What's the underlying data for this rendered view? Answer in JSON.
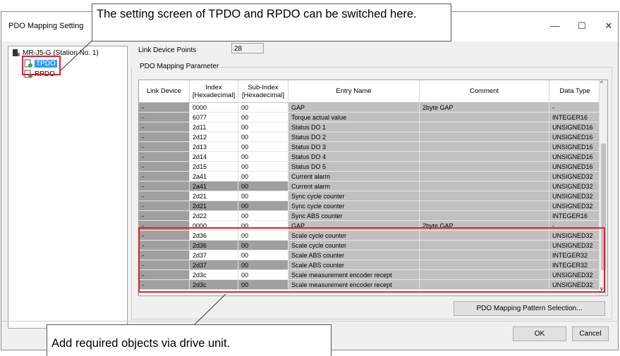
{
  "window": {
    "title": "PDO Mapping Setting",
    "minimize": "—",
    "maximize": "☐",
    "close": "✕"
  },
  "tree": {
    "station": "MR-J5-G (Station No. 1)",
    "tpdo": "TPDO",
    "rpdo": "RPDO"
  },
  "link_points": {
    "label": "Link Device Points",
    "value": "28"
  },
  "group_label": "PDO Mapping Parameter",
  "table": {
    "headers": {
      "link": "Link Device",
      "index": "Index [Hexadecimal]",
      "sub": "Sub-Index [Hexadecimal]",
      "entry": "Entry Name",
      "comment": "Comment",
      "type": "Data Type"
    },
    "rows": [
      {
        "link": "-",
        "index": "0000",
        "sub": "00",
        "entry": "GAP",
        "comment": "2byte GAP",
        "type": "-"
      },
      {
        "link": "-",
        "index": "6077",
        "sub": "00",
        "entry": "Torque actual value",
        "comment": "",
        "type": "INTEGER16"
      },
      {
        "link": "-",
        "index": "2d11",
        "sub": "00",
        "entry": "Status DO 1",
        "comment": "",
        "type": "UNSIGNED16"
      },
      {
        "link": "-",
        "index": "2d12",
        "sub": "00",
        "entry": "Status DO 2",
        "comment": "",
        "type": "UNSIGNED16"
      },
      {
        "link": "-",
        "index": "2d13",
        "sub": "00",
        "entry": "Status DO 3",
        "comment": "",
        "type": "UNSIGNED16"
      },
      {
        "link": "-",
        "index": "2d14",
        "sub": "00",
        "entry": "Status DO 4",
        "comment": "",
        "type": "UNSIGNED16"
      },
      {
        "link": "-",
        "index": "2d15",
        "sub": "00",
        "entry": "Status DO 5",
        "comment": "",
        "type": "UNSIGNED16"
      },
      {
        "link": "-",
        "index": "2a41",
        "sub": "00",
        "entry": "Current alarm",
        "comment": "",
        "type": "UNSIGNED32"
      },
      {
        "link": "-",
        "index": "2a41",
        "sub": "00",
        "entry": "Current alarm",
        "comment": "",
        "type": "UNSIGNED32"
      },
      {
        "link": "-",
        "index": "2d21",
        "sub": "00",
        "entry": "Sync cycle counter",
        "comment": "",
        "type": "UNSIGNED32"
      },
      {
        "link": "-",
        "index": "2d21",
        "sub": "00",
        "entry": "Sync cycle counter",
        "comment": "",
        "type": "UNSIGNED32"
      },
      {
        "link": "-",
        "index": "2d22",
        "sub": "00",
        "entry": "Sync ABS counter",
        "comment": "",
        "type": "INTEGER16"
      },
      {
        "link": "-",
        "index": "0000",
        "sub": "00",
        "entry": "GAP",
        "comment": "2byte GAP",
        "type": "-"
      },
      {
        "link": "-",
        "index": "2d36",
        "sub": "00",
        "entry": "Scale cycle counter",
        "comment": "",
        "type": "UNSIGNED32"
      },
      {
        "link": "-",
        "index": "2d36",
        "sub": "00",
        "entry": "Scale cycle counter",
        "comment": "",
        "type": "UNSIGNED32"
      },
      {
        "link": "-",
        "index": "2d37",
        "sub": "00",
        "entry": "Scale ABS counter",
        "comment": "",
        "type": "INTEGER32"
      },
      {
        "link": "-",
        "index": "2d37",
        "sub": "00",
        "entry": "Scale ABS counter",
        "comment": "",
        "type": "INTEGER32"
      },
      {
        "link": "-",
        "index": "2d3c",
        "sub": "00",
        "entry": "Scale measurement encoder recept",
        "comment": "",
        "type": "UNSIGNED32"
      },
      {
        "link": "-",
        "index": "2d3c",
        "sub": "00",
        "entry": "Scale measurement encoder recept",
        "comment": "",
        "type": "UNSIGNED32"
      }
    ]
  },
  "buttons": {
    "pattern": "PDO Mapping Pattern Selection...",
    "ok": "OK",
    "cancel": "Cancel"
  },
  "callouts": {
    "top": "The setting screen of TPDO and RPDO can be switched here.",
    "bottom": "Add required objects via drive unit."
  },
  "colors": {
    "selection": "#3399ff",
    "highlight": "#e0202c",
    "gray_cell": "#a0a0a0",
    "gray_row": "#c0c0c0"
  }
}
